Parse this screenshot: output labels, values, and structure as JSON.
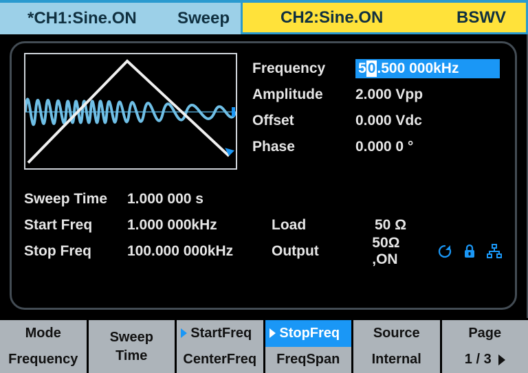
{
  "header": {
    "ch1_label": "*CH1:Sine.ON",
    "ch1_mode": "Sweep",
    "ch2_label": "CH2:Sine.ON",
    "right_tag": "BSWV"
  },
  "params": {
    "frequency_label": "Frequency",
    "frequency_prefix": "5",
    "frequency_cursor_digit": "0",
    "frequency_suffix": ".500 000kHz",
    "amplitude_label": "Amplitude",
    "amplitude_value": "2.000 Vpp",
    "offset_label": "Offset",
    "offset_value": "0.000 Vdc",
    "phase_label": "Phase",
    "phase_value": "0.000 0 °"
  },
  "sweep": {
    "sweep_time_label": "Sweep Time",
    "sweep_time_value": "1.000 000 s",
    "start_freq_label": "Start Freq",
    "start_freq_value": "1.000 000kHz",
    "stop_freq_label": "Stop Freq",
    "stop_freq_value": "100.000 000kHz"
  },
  "output": {
    "load_label": "Load",
    "load_value": "50 Ω",
    "output_label": "Output",
    "output_value": "50Ω ,ON"
  },
  "icons": {
    "refresh": "refresh-icon",
    "lock": "lock-icon",
    "network": "network-icon"
  },
  "softkeys": [
    {
      "top": "Mode",
      "bottom": "Frequency",
      "top_marker": false,
      "bottom_selected": false
    },
    {
      "top": "Sweep",
      "bottom": "Time",
      "top_marker": false,
      "bottom_selected": false,
      "merged": true
    },
    {
      "top": "StartFreq",
      "bottom": "CenterFreq",
      "top_marker": true,
      "bottom_selected": false
    },
    {
      "top": "StopFreq",
      "bottom": "FreqSpan",
      "top_marker": true,
      "bottom_selected": false,
      "top_selected": true
    },
    {
      "top": "Source",
      "bottom": "Internal",
      "top_marker": false,
      "bottom_selected": false
    },
    {
      "top": "Page",
      "bottom": "1 / 3",
      "top_marker": false,
      "bottom_selected": false,
      "arrow": true
    }
  ],
  "colors": {
    "accent": "#1a97f6",
    "header_bg": "#9cd0e8",
    "ch2_bg": "#ffe23a",
    "wave": "#6fbfe6"
  }
}
